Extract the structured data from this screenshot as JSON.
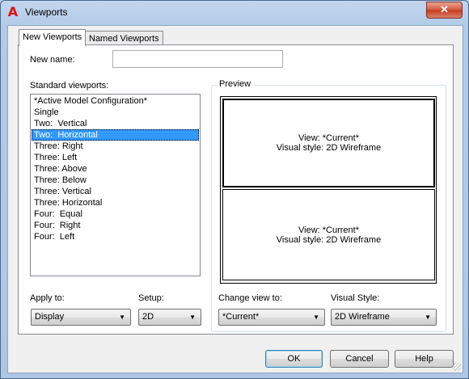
{
  "window": {
    "title": "Viewports",
    "app_icon": "autocad-a-icon",
    "close_glyph": "✕"
  },
  "tabs": [
    {
      "label": "New Viewports",
      "active": true
    },
    {
      "label": "Named Viewports",
      "active": false
    }
  ],
  "new_name": {
    "label": "New name:",
    "value": ""
  },
  "standard_viewports": {
    "label": "Standard viewports:",
    "items": [
      "*Active Model Configuration*",
      "Single",
      "Two:  Vertical",
      "Two:  Horizontal",
      "Three: Right",
      "Three: Left",
      "Three: Above",
      "Three: Below",
      "Three: Vertical",
      "Three: Horizontal",
      "Four:  Equal",
      "Four:  Right",
      "Four:  Left"
    ],
    "selected_index": 3
  },
  "preview": {
    "label": "Preview",
    "top_viewport": {
      "view": "View: *Current*",
      "style": "Visual style: 2D Wireframe"
    },
    "bottom_viewport": {
      "view": "View: *Current*",
      "style": "Visual style: 2D Wireframe"
    }
  },
  "apply_to": {
    "label": "Apply to:",
    "value": "Display"
  },
  "setup": {
    "label": "Setup:",
    "value": "2D"
  },
  "change_view_to": {
    "label": "Change view to:",
    "value": "*Current*"
  },
  "visual_style": {
    "label": "Visual Style:",
    "value": "2D Wireframe"
  },
  "buttons": {
    "ok": "OK",
    "cancel": "Cancel",
    "help": "Help"
  },
  "colors": {
    "selection": "#3399ff",
    "close_button": "#c43a1b",
    "app_icon": "#dd1111"
  }
}
